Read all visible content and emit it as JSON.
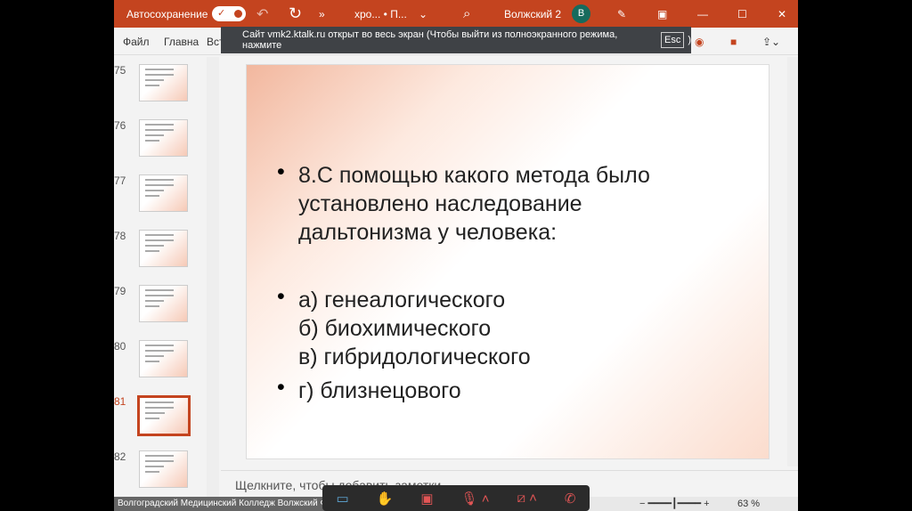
{
  "titlebar": {
    "autosave": "Автосохранение",
    "doc": "хро... • П...",
    "user": "Волжский 2",
    "avatar": "В",
    "more": "»"
  },
  "ribbon": {
    "tabs": [
      "Файл",
      "Главна",
      "Вставка"
    ]
  },
  "toast": {
    "text": "Сайт vmk2.ktalk.ru открыт во весь экран (Чтобы выйти из полноэкранного режима, нажмите",
    "key": "Esc",
    "end": ")"
  },
  "thumbnails": [
    {
      "n": "75"
    },
    {
      "n": "76"
    },
    {
      "n": "77"
    },
    {
      "n": "78"
    },
    {
      "n": "79"
    },
    {
      "n": "80"
    },
    {
      "n": "81",
      "active": true
    },
    {
      "n": "82"
    }
  ],
  "slide": {
    "question": [
      "8.С помощью какого метода было",
      "установлено наследование",
      "дальтонизма у человека:"
    ],
    "options": [
      "а) генеалогического",
      "б) биохимического",
      "в) гибридологического",
      "г) близнецового"
    ]
  },
  "notes": {
    "placeholder": "Щелкните, чтобы добавить заметки"
  },
  "status": {
    "caption": "Волгоградский Медицинский Колледж Волжский Ф",
    "zoom": "63 %"
  },
  "accent": "#c4441f"
}
